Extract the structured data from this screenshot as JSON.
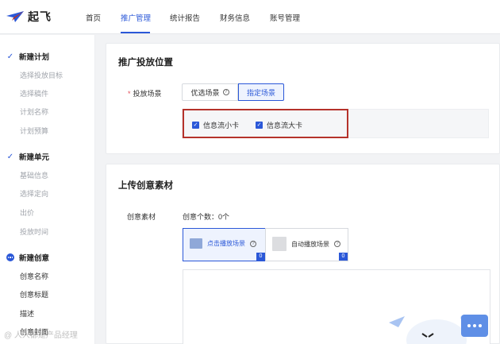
{
  "brand": {
    "name": "起飞",
    "logo_icon": "paper-plane-icon",
    "accent": "#2b58d8"
  },
  "nav": {
    "items": [
      "首页",
      "推广管理",
      "统计报告",
      "财务信息",
      "账号管理"
    ],
    "active": "推广管理"
  },
  "sidebar": {
    "steps": [
      {
        "title": "新建计划",
        "status": "done",
        "subs": [
          "选择投放目标",
          "选择稿件",
          "计划名称",
          "计划预算"
        ]
      },
      {
        "title": "新建单元",
        "status": "done",
        "subs": [
          "基础信息",
          "选择定向",
          "出价",
          "投放时间"
        ]
      },
      {
        "title": "新建创意",
        "status": "current",
        "subs": [
          "创意名称",
          "创意标题",
          "描述",
          "创意封面"
        ]
      }
    ]
  },
  "placement": {
    "title": "推广投放位置",
    "scene_label": "投放场景",
    "scene_options": [
      "优选场景",
      "指定场景"
    ],
    "selected_scene": "指定场景",
    "checkboxes": [
      {
        "label": "信息流小卡",
        "checked": true
      },
      {
        "label": "信息流大卡",
        "checked": true
      }
    ]
  },
  "creative": {
    "title": "上传创意素材",
    "label": "创意素材",
    "count_text": "创意个数：0个",
    "tiles": [
      {
        "label": "点击播放场景",
        "count": "0",
        "active": true
      },
      {
        "label": "自动播放场景",
        "count": "0",
        "active": false
      }
    ]
  },
  "watermark": "@ 人人都是产品经理"
}
